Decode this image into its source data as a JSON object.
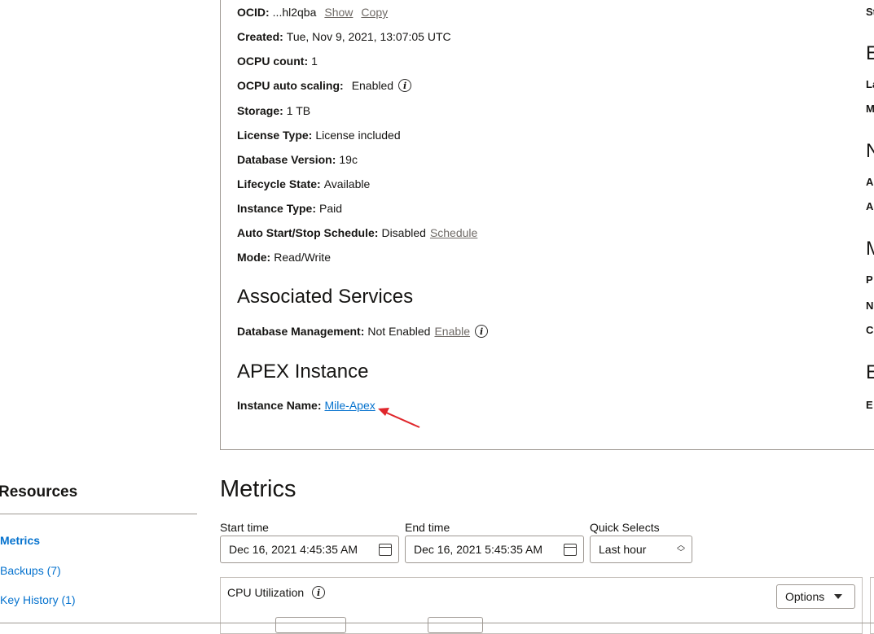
{
  "details": {
    "ocid": {
      "label": "OCID:",
      "value": "...hl2qba",
      "show": "Show",
      "copy": "Copy"
    },
    "created": {
      "label": "Created:",
      "value": "Tue, Nov 9, 2021, 13:07:05 UTC"
    },
    "ocpu_count": {
      "label": "OCPU count:",
      "value": "1"
    },
    "ocpu_auto_scaling": {
      "label": "OCPU auto scaling:",
      "value": "Enabled"
    },
    "storage": {
      "label": "Storage:",
      "value": "1 TB"
    },
    "license_type": {
      "label": "License Type:",
      "value": "License included"
    },
    "database_version": {
      "label": "Database Version:",
      "value": "19c"
    },
    "lifecycle_state": {
      "label": "Lifecycle State:",
      "value": "Available"
    },
    "instance_type": {
      "label": "Instance Type:",
      "value": "Paid"
    },
    "auto_schedule": {
      "label": "Auto Start/Stop Schedule:",
      "value": "Disabled",
      "link": "Schedule"
    },
    "mode": {
      "label": "Mode:",
      "value": "Read/Write"
    }
  },
  "associated_services": {
    "title": "Associated Services",
    "db_management": {
      "label": "Database Management:",
      "value": "Not Enabled",
      "link": "Enable"
    }
  },
  "apex": {
    "title": "APEX Instance",
    "instance_name": {
      "label": "Instance Name:",
      "value": "Mile-Apex"
    }
  },
  "right_column_fragments": [
    "St",
    "E",
    "La",
    "M",
    "N",
    "A",
    "A",
    "M",
    "P",
    "N",
    "C",
    "E",
    "E"
  ],
  "resources": {
    "title": "Resources",
    "items": [
      {
        "label": "Metrics",
        "active": true
      },
      {
        "label": "Backups (7)",
        "active": false
      },
      {
        "label": "Key History (1)",
        "active": false
      }
    ]
  },
  "metrics": {
    "title": "Metrics",
    "start_time": {
      "label": "Start time",
      "value": "Dec 16, 2021 4:45:35 AM"
    },
    "end_time": {
      "label": "End time",
      "value": "Dec 16, 2021 5:45:35 AM"
    },
    "quick_selects": {
      "label": "Quick Selects",
      "value": "Last hour"
    },
    "cpu_card": {
      "title": "CPU Utilization",
      "options_label": "Options"
    }
  },
  "colors": {
    "link": "#0572ce",
    "annotation_arrow": "#e0262b",
    "border": "#9e9892"
  }
}
